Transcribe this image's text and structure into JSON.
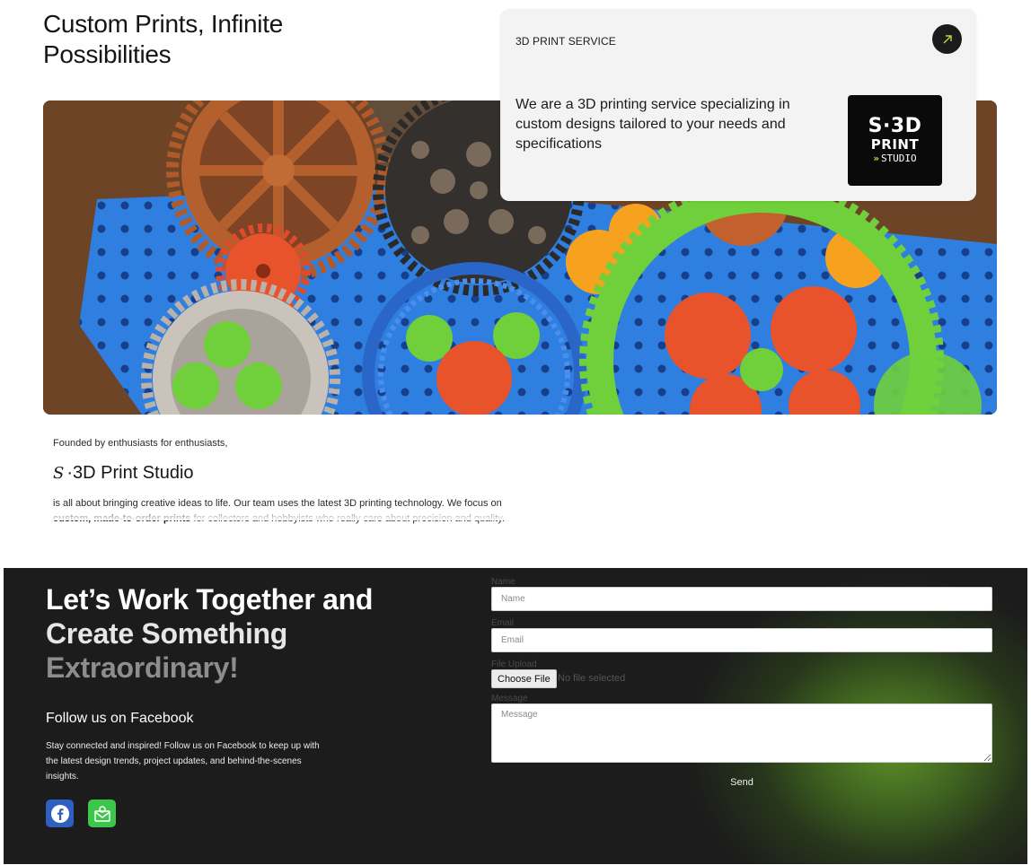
{
  "hero": {
    "title_line1": "Custom Prints, Infinite",
    "title_line2": "Possibilities"
  },
  "service_card": {
    "label": "3D PRINT SERVICE",
    "description": "We are a 3D printing service specializing in custom designs tailored to your needs and specifications",
    "logo": {
      "line1": "S·3D",
      "line2": "PRINT",
      "line3": "STUDIO",
      "accent": "#c6e23a"
    },
    "arrow_icon": "arrow-up-right-icon"
  },
  "about": {
    "founded": "Founded by enthusiasts for enthusiasts,",
    "studio_mark": "S",
    "studio_name": "·3D Print Studio",
    "text_part1": "is all about bringing creative ideas to life. Our team uses the latest 3D printing technology. We focus on",
    "text_bold": "custom, made-to-order prints",
    "text_part2": " for collectors and hobbyists who really care about precision and quality."
  },
  "contact": {
    "title_line1": "Let’s Work Together and",
    "title_line2": "Create Something",
    "title_line3": "Extraordinary!",
    "facebook_heading": "Follow us on Facebook",
    "facebook_text": "Stay connected and inspired! Follow us on Facebook to keep up with the latest design trends, project updates, and behind-the-scenes insights.",
    "icons": [
      "facebook-icon",
      "email-icon"
    ],
    "colors": {
      "facebook": "#2f5fbf",
      "email": "#3bc84a",
      "glow": "#5f8f28"
    }
  },
  "form": {
    "name_label": "Name",
    "name_placeholder": "Name",
    "email_label": "Email",
    "email_placeholder": "Email",
    "file_label": "File Upload",
    "file_button": "Choose File",
    "file_status": "No file selected",
    "message_label": "Message",
    "message_placeholder": "Message",
    "send_label": "Send"
  }
}
